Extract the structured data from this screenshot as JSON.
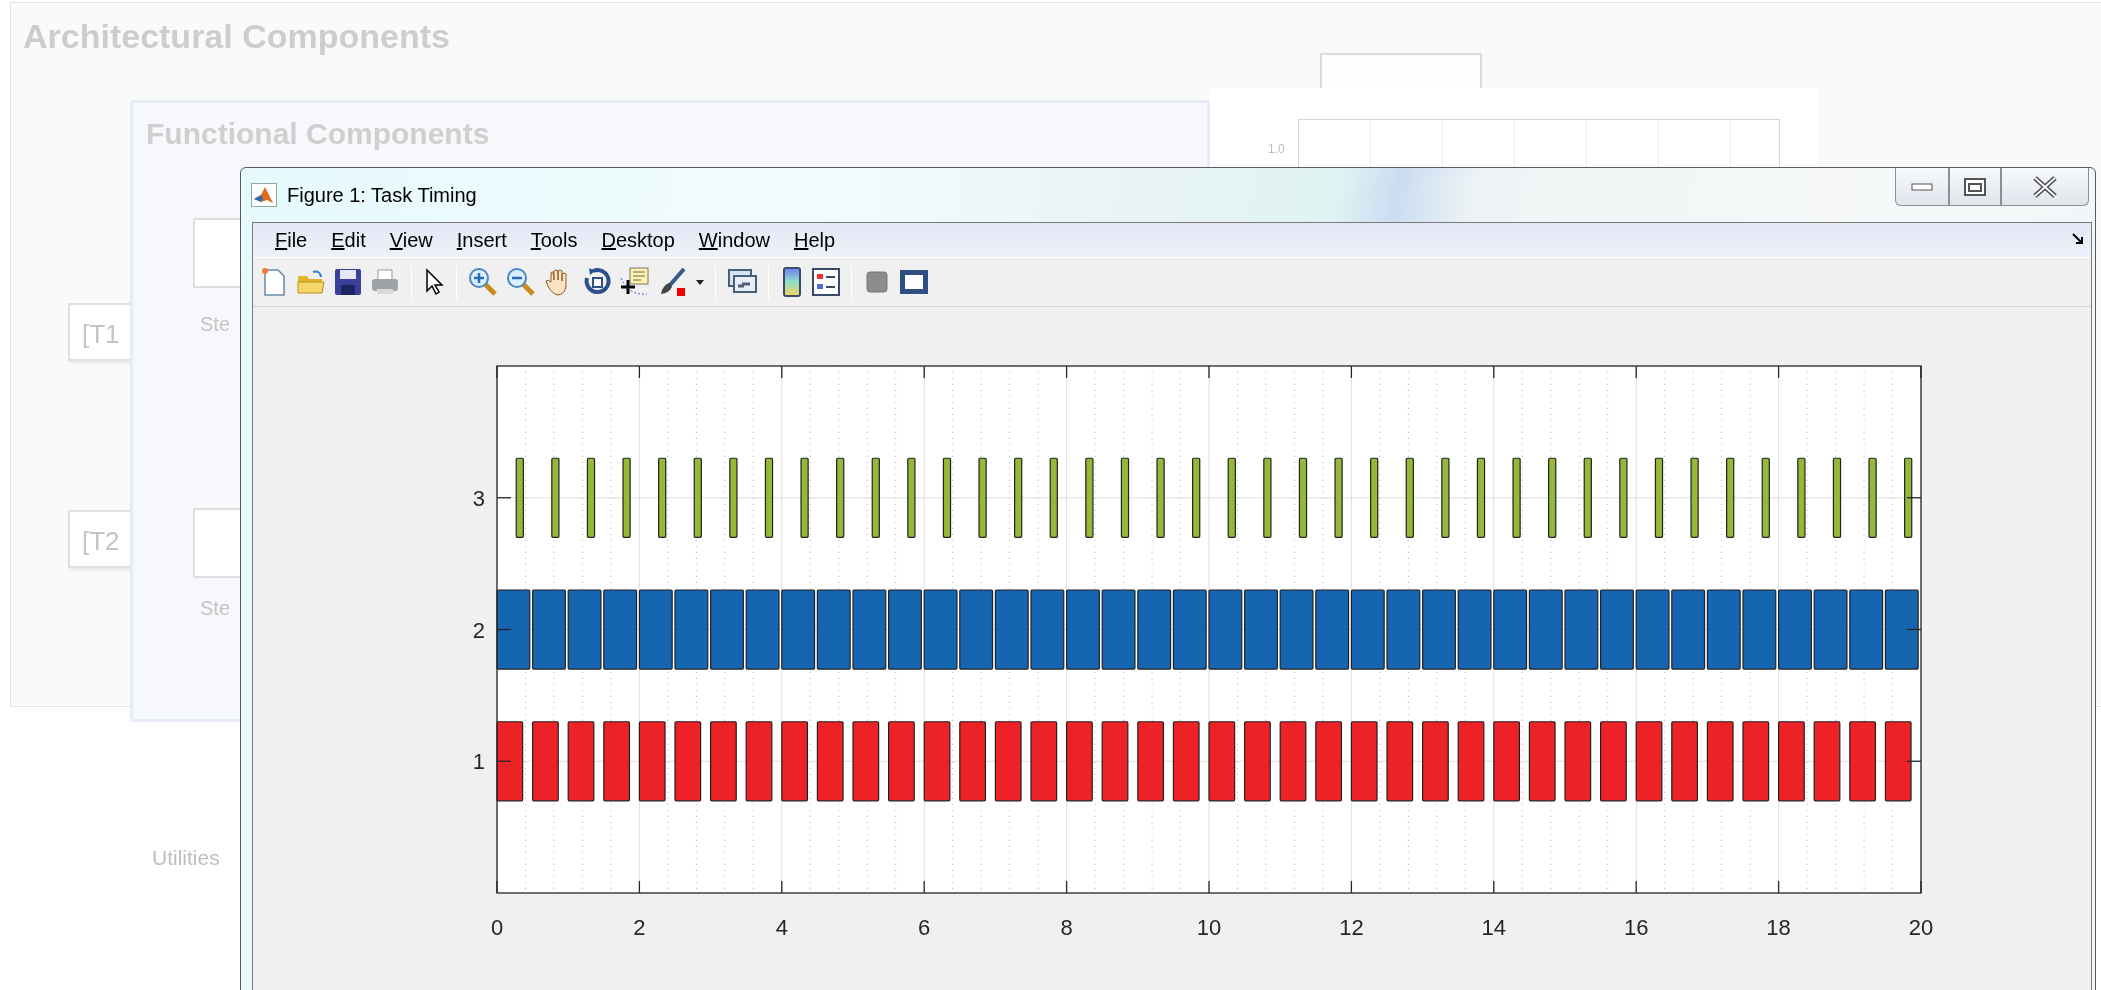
{
  "background": {
    "architectural_panel": {
      "title": "Architectural Components",
      "blocks": [
        {
          "label": "[T1"
        },
        {
          "label": "[T2"
        }
      ]
    },
    "functional_panel": {
      "title": "Functional Components",
      "blocks": [
        {
          "label": "Ste"
        },
        {
          "label": "Ste"
        }
      ]
    },
    "plot_preview": {
      "ytick": "1.0"
    },
    "utilities_label": "Utilities"
  },
  "figure": {
    "title": "Figure 1: Task Timing",
    "menu": [
      {
        "label": "File"
      },
      {
        "label": "Edit"
      },
      {
        "label": "View"
      },
      {
        "label": "Insert"
      },
      {
        "label": "Tools"
      },
      {
        "label": "Desktop"
      },
      {
        "label": "Window"
      },
      {
        "label": "Help"
      }
    ],
    "axes": {
      "xtick_labels": [
        "0",
        "2",
        "4",
        "6",
        "8",
        "10",
        "12",
        "14",
        "16",
        "18",
        "20"
      ],
      "ytick_labels": [
        "3",
        "2",
        "1"
      ]
    }
  }
}
